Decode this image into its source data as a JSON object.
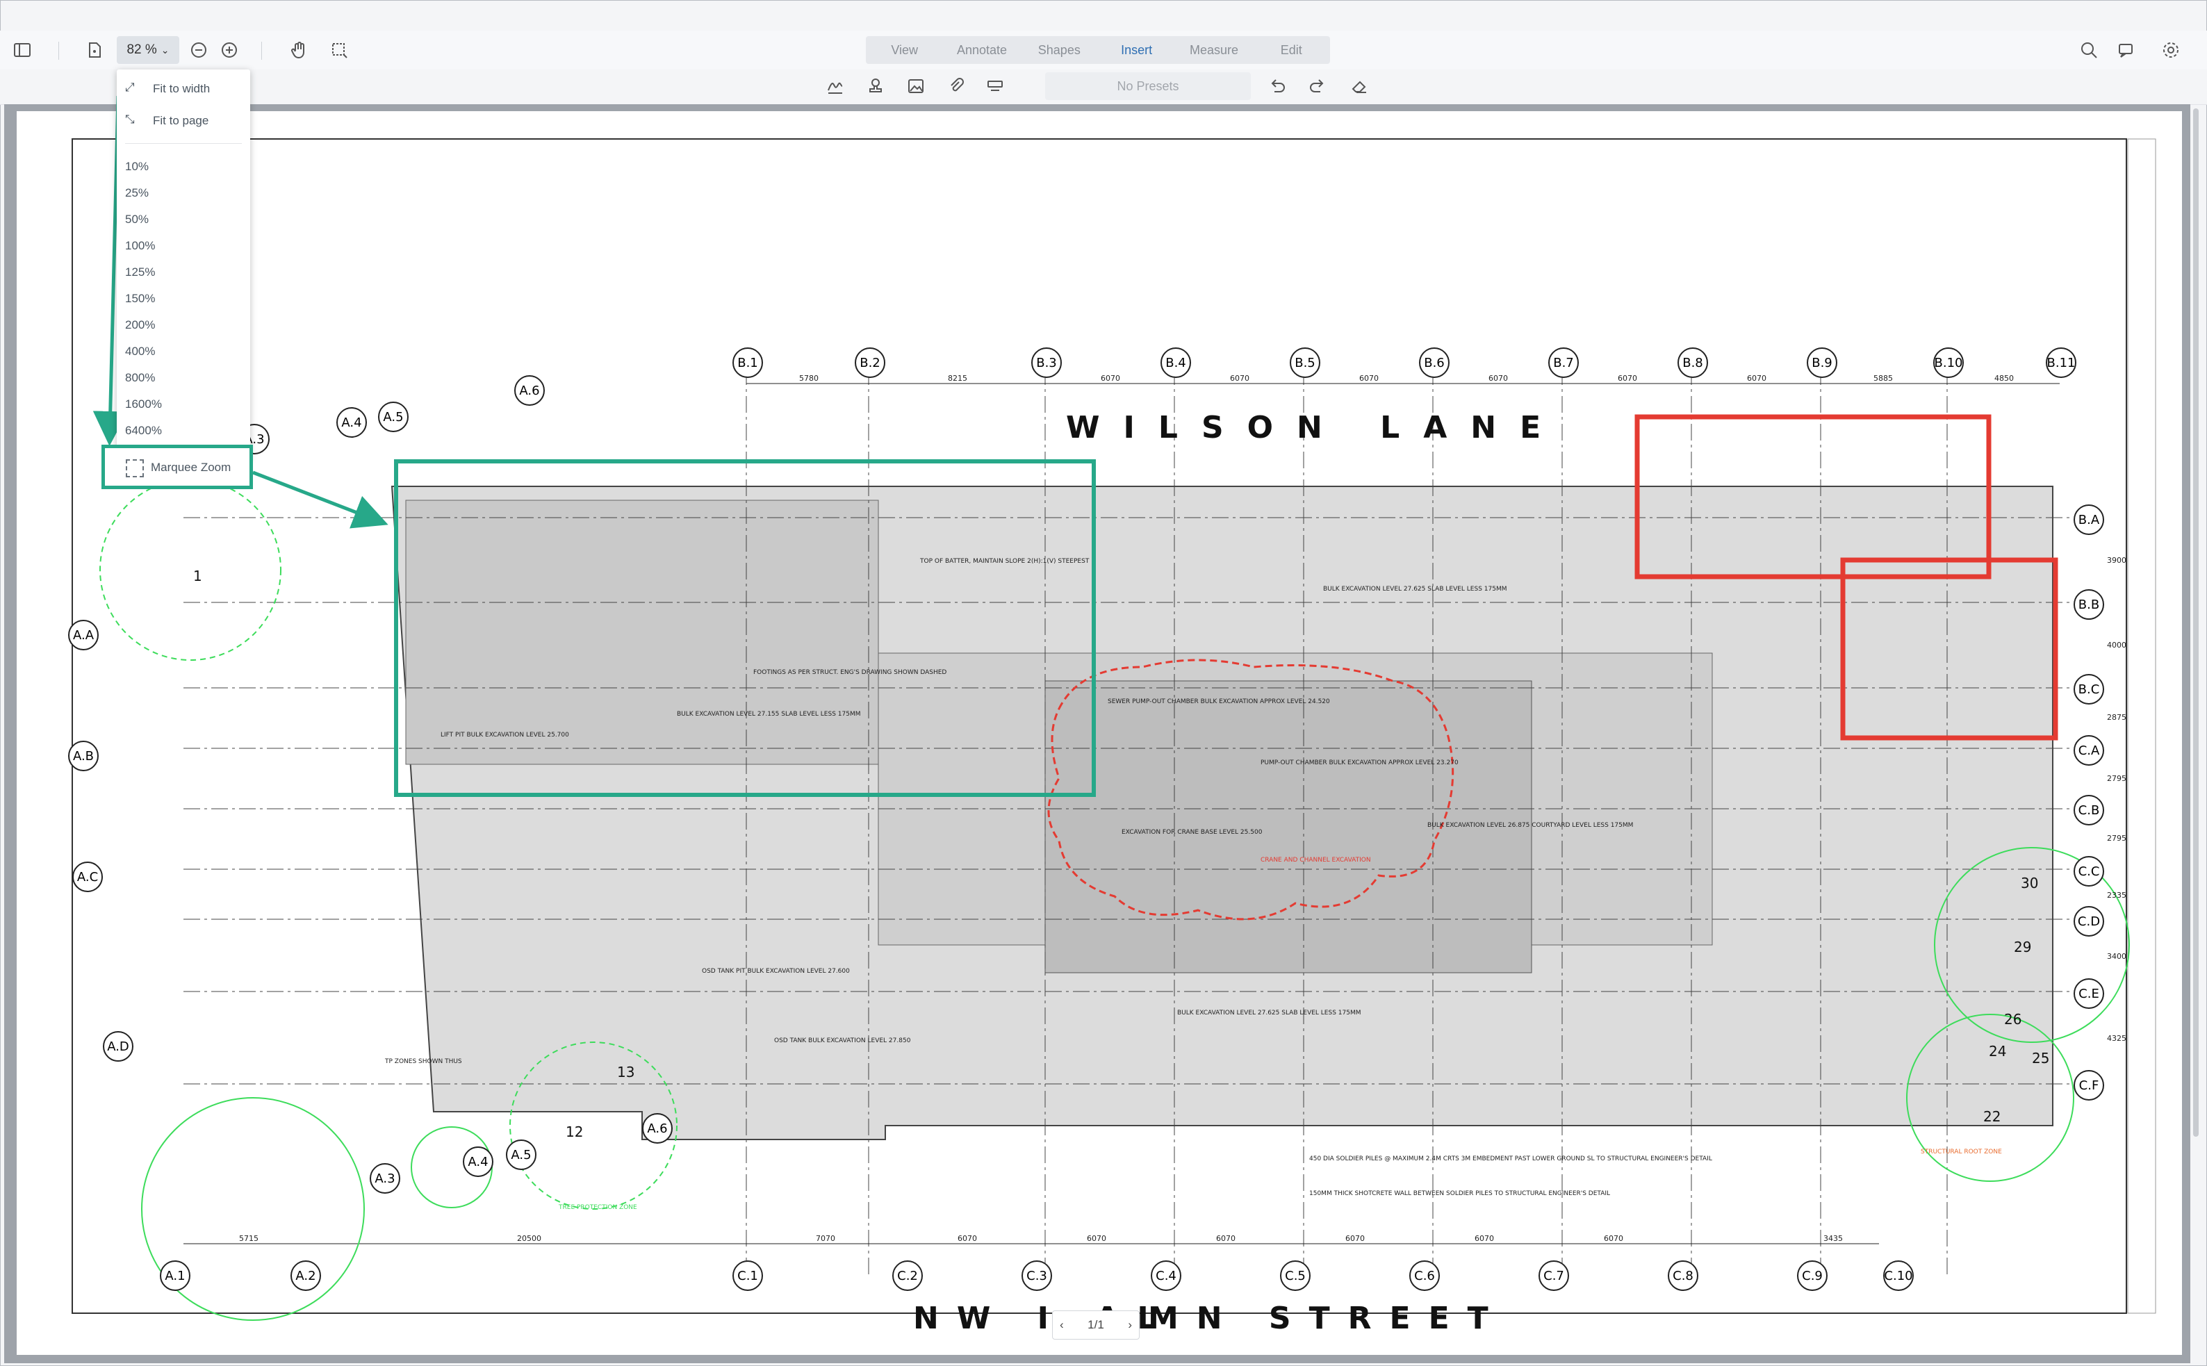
{
  "toolbar": {
    "zoom_value": "82 %",
    "tabs": [
      {
        "label": "View"
      },
      {
        "label": "Annotate"
      },
      {
        "label": "Shapes"
      },
      {
        "label": "Insert",
        "active": true
      },
      {
        "label": "Measure"
      },
      {
        "label": "Edit"
      }
    ],
    "presets_label": "No Presets"
  },
  "zoom_menu": {
    "fit_width": "Fit to width",
    "fit_page": "Fit to page",
    "levels": [
      "10%",
      "25%",
      "50%",
      "100%",
      "125%",
      "150%",
      "200%",
      "400%",
      "800%",
      "1600%",
      "6400%"
    ],
    "marquee": "Marquee Zoom"
  },
  "pager": {
    "label": "1/1"
  },
  "drawing": {
    "street_top": "WILSON  LANE",
    "street_bottom_left": "NW I AL",
    "street_bottom_right": "MN   STREET",
    "grid_b": [
      "B.1",
      "B.2",
      "B.3",
      "B.4",
      "B.5",
      "B.6",
      "B.7",
      "B.8",
      "B.9",
      "B.10",
      "B.11"
    ],
    "dims_top": [
      "5780",
      "8215",
      "6070",
      "6070",
      "6070",
      "6070",
      "6070",
      "6070",
      "5885",
      "4850"
    ],
    "grid_c": [
      "C.1",
      "C.2",
      "C.3",
      "C.4",
      "C.5",
      "C.6",
      "C.7",
      "C.8",
      "C.9",
      "C.10"
    ],
    "grid_a_bottom": [
      "A.1",
      "A.2"
    ],
    "dims_bottom": [
      "5715",
      "20500",
      "7070",
      "6070",
      "6070",
      "6070",
      "6070",
      "6070",
      "6070",
      "3435"
    ],
    "grid_right": [
      "B.A",
      "B.B",
      "B.C",
      "C.A",
      "C.B",
      "C.C",
      "C.D",
      "C.E",
      "C.F"
    ],
    "dims_right": [
      "3900",
      "4000",
      "2875",
      "2795",
      "2795",
      "2335",
      "3400",
      "4325"
    ],
    "grid_left": [
      "A.A",
      "A.B",
      "A.C",
      "A.D"
    ],
    "grid_a_top": [
      "A.3",
      "A.4",
      "A.5",
      "A.6"
    ],
    "grid_a_lower": [
      "A.3",
      "A.4",
      "A.5",
      "A.6"
    ],
    "tree_numbers": [
      "1",
      "12",
      "13",
      "22",
      "24",
      "25",
      "26",
      "29",
      "30"
    ],
    "notes": [
      "TOP OF BATTER, MAINTAIN SLOPE 2(H):1(V) STEEPEST",
      "BULK EXCAVATION LEVEL 27.625 SLAB LEVEL LESS 175MM",
      "FOOTINGS AS PER STRUCT. ENG'S DRAWING SHOWN DASHED",
      "BULK EXCAVATION LEVEL 27.155 SLAB LEVEL LESS 175MM",
      "LIFT PIT BULK EXCAVATION LEVEL 25.700",
      "SEWER PUMP-OUT CHAMBER BULK EXCAVATION APPROX LEVEL 24.520",
      "PUMP-OUT CHAMBER BULK EXCAVATION APPROX LEVEL 23.270",
      "EXCAVATION FOR CRANE BASE LEVEL 25.500",
      "BULK EXCAVATION LEVEL 26.875 COURTYARD LEVEL LESS 175MM",
      "BULK EXCAVATION LEVEL 27.625 SLAB LEVEL LESS 175MM",
      "OSD TANK PIT BULK EXCAVATION LEVEL 27.600",
      "OSD TANK BULK EXCAVATION LEVEL 27.850",
      "450 DIA SOLDIER PILES @ MAXIMUM 2.4M CRTS 3M EMBEDMENT PAST LOWER GROUND SL TO STRUCTURAL ENGINEER'S DETAIL",
      "150MM THICK SHOTCRETE WALL BETWEEN SOLDIER PILES TO STRUCTURAL ENGINEER'S DETAIL",
      "TP ZONES SHOWN THUS",
      "STRUCTURAL ROOT ZONE",
      "TREE PROTECTION ZONE",
      "CRANE AND CHANNEL EXCAVATION"
    ],
    "colors": {
      "annotation_green": "#27a889",
      "cloud_red": "#e43b32",
      "tree_green": "#3ddc5b"
    }
  }
}
